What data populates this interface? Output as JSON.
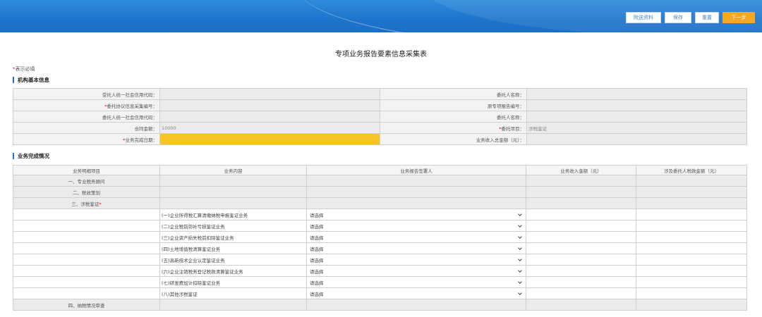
{
  "toolbar": {
    "buttons": [
      {
        "label": "附送资料"
      },
      {
        "label": "保存"
      },
      {
        "label": "重置"
      },
      {
        "label": "下一步"
      }
    ]
  },
  "page": {
    "title": "专项业务报告要素信息采集表",
    "required_star": "*",
    "required_note": "表示必填"
  },
  "basic_info": {
    "title": "机构基本信息",
    "rows": [
      {
        "left_label": "受托人统一社会信用代码：",
        "left_value": "",
        "right_label": "委托人名称：",
        "right_value": ""
      },
      {
        "left_star": "*",
        "left_label": "委托协议信息采集编号：",
        "left_value": "",
        "right_label": "原专项报告编号：",
        "right_value": ""
      },
      {
        "left_label": "委托人统一社会信用代码：",
        "left_value": "",
        "right_label": "委托人名称：",
        "right_value": ""
      },
      {
        "left_label": "合同金额：",
        "left_value": "10000",
        "right_star": "*",
        "right_label": "委托项目：",
        "right_value": "涉税鉴证"
      },
      {
        "left_star": "*",
        "left_label": "业务完成日期：",
        "left_value": "",
        "right_label": "业务收入总金额（元）：",
        "right_value": ""
      }
    ]
  },
  "business": {
    "title": "业务完成情况",
    "headers": [
      "业务明细项目",
      "业务内容",
      "业务报告签署人",
      "业务收入金额（元）",
      "涉及委托人税款金额（元）"
    ],
    "categories": [
      {
        "label": "一、专业税务顾问"
      },
      {
        "label": "二、税收策划"
      },
      {
        "label": "三、涉税鉴证",
        "star": "*"
      }
    ],
    "select_placeholder": "请选择",
    "items": [
      "(一)企业所得税汇算清缴纳税申报鉴证业务",
      "(二)企业税前弥补亏损鉴证业务",
      "(三)企业资产损失税前扣除鉴证业务",
      "(四)土地增值税清算鉴证业务",
      "(五)高新技术企业认定鉴证业务",
      "(六)企业注销税务登记税款清算鉴证业务",
      "(七)研发费加计扣除鉴证业务",
      "(八)其他涉税鉴证"
    ],
    "last_category": "四、纳税情况审查"
  }
}
